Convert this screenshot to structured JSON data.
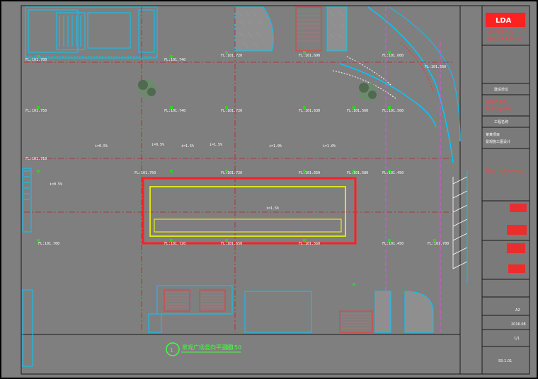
{
  "drawing": {
    "title": "景观广场竖向平面图",
    "scale": "1/150",
    "sheet_number": "1"
  },
  "title_block": {
    "logo_text": "LDA",
    "company": [
      "深圳市保合泰",
      "园林技术有限公司"
    ],
    "section_client": "建设单位",
    "client": [
      "某某房地产",
      "开发有限公司"
    ],
    "section_project": "工程名称",
    "project": [
      "某某项目",
      "景观施工图设计"
    ],
    "drawing_name": "景观广场竖向平面图",
    "sheet_size": "A2",
    "date": "2016.08",
    "version": "1/1",
    "sheet_no": "SS-1.01"
  },
  "elevations": [
    "FL:101.700",
    "FL:101.740",
    "FL:101.720",
    "FL:101.690",
    "FL:101.600",
    "FL:101.560",
    "FL:101.750",
    "FL:101.740",
    "FL:101.720",
    "FL:101.630",
    "FL:101.560",
    "FL:101.500",
    "FL:101.710",
    "FL:101.750",
    "FL:101.720",
    "FL:101.650",
    "FL:101.580",
    "FL:101.450",
    "FL:101.700",
    "FL:101.720",
    "FL:101.650",
    "FL:101.560",
    "FL:101.450",
    "FL:101.700"
  ],
  "slopes": [
    "i=0.5%",
    "i=0.5%",
    "i=1.5%",
    "i=1.5%",
    "i=1.0%",
    "i=1.0%",
    "i=1.5%",
    "i=0.5%"
  ]
}
